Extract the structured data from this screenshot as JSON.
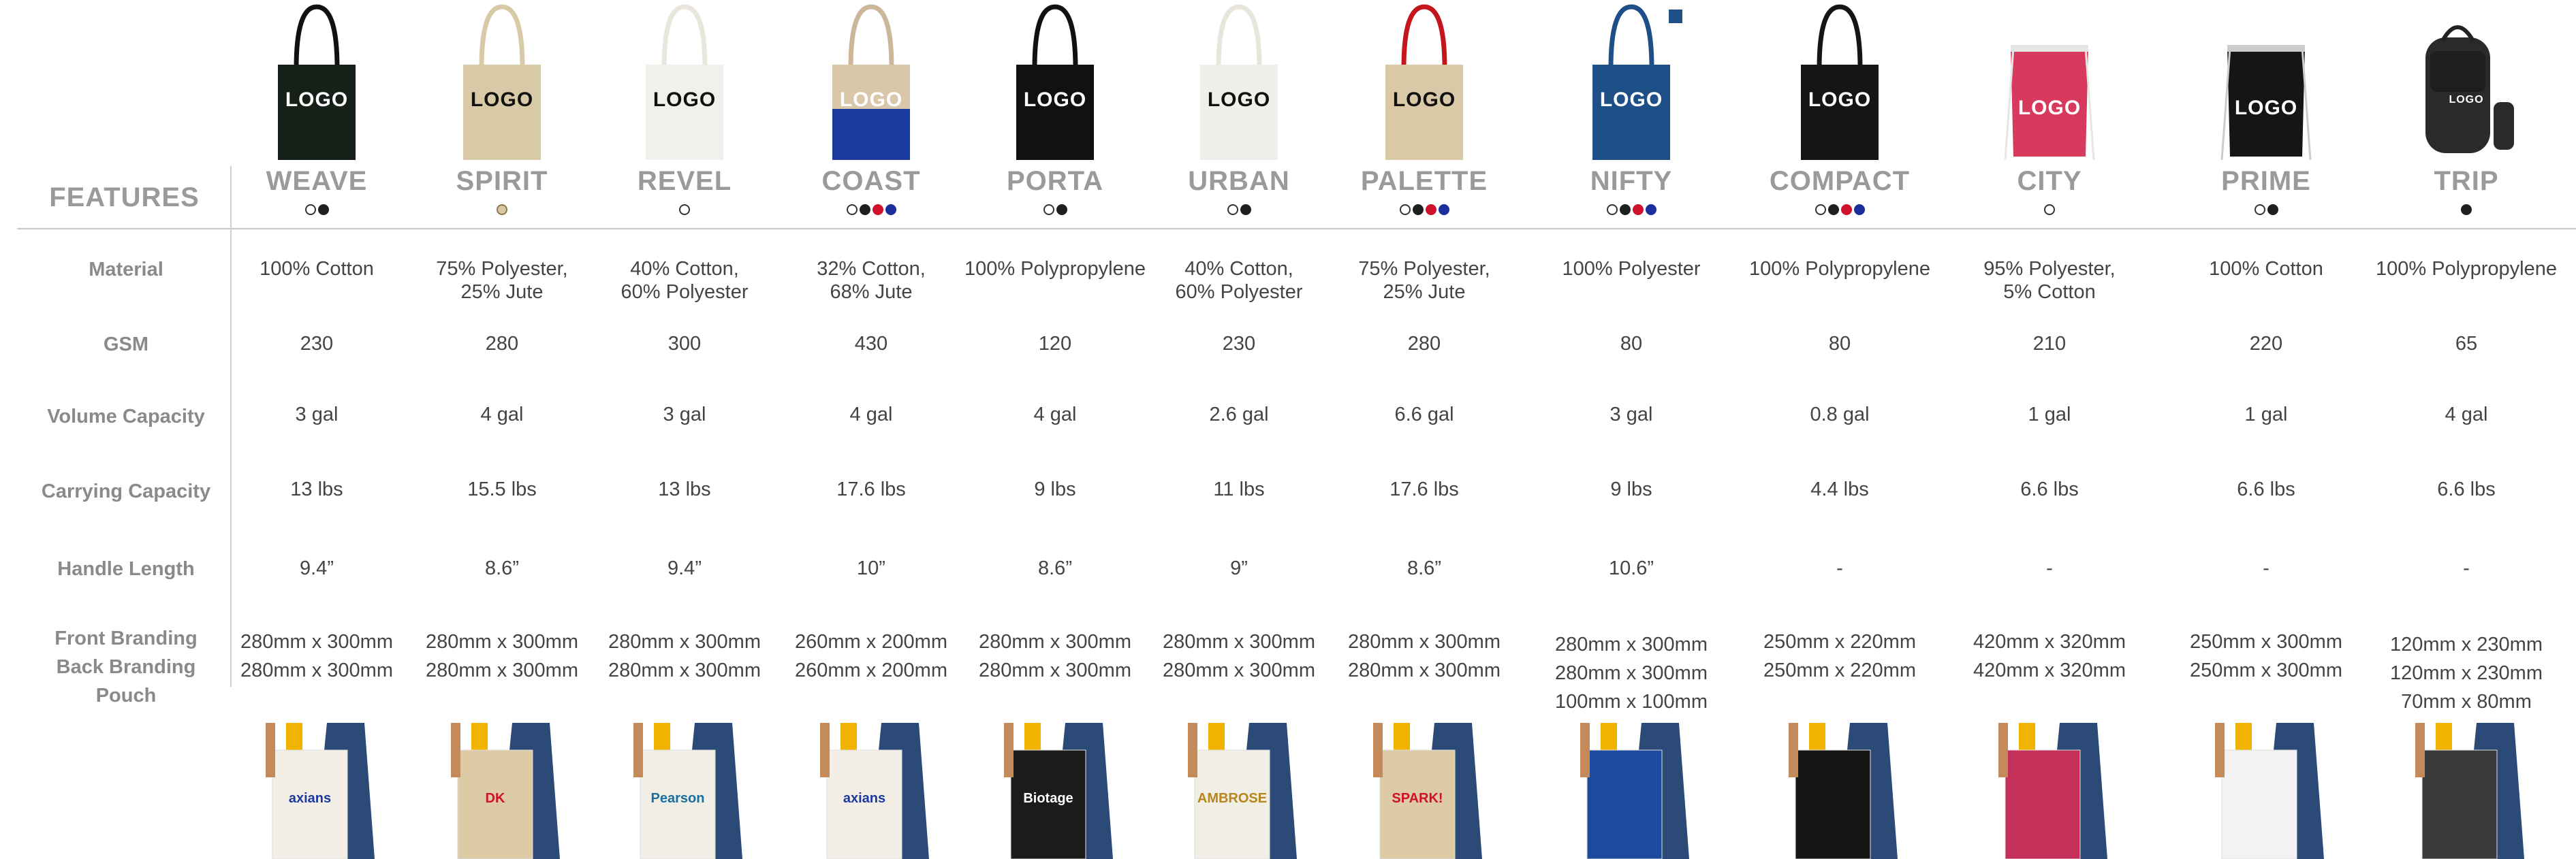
{
  "features_title": "FEATURES",
  "row_labels": [
    "Material",
    "GSM",
    "Volume Capacity",
    "Carrying Capacity",
    "Handle Length",
    "Front Branding",
    "Back Branding",
    "Pouch"
  ],
  "products": [
    {
      "name": "WEAVE",
      "logo": "LOGO",
      "colors": [
        "#ffffff",
        "#1f1f1f"
      ],
      "bag_color": "#142018",
      "handle_color": "#111111",
      "logo_color": "#ffffff",
      "material": [
        "100% Cotton"
      ],
      "gsm": "230",
      "volume": "3 gal",
      "carry": "13 lbs",
      "handle": "9.4”",
      "branding": [
        "280mm x 300mm",
        "280mm x 300mm"
      ],
      "photo_brand": "axians",
      "photo_bag": "#f3efe6"
    },
    {
      "name": "SPIRIT",
      "logo": "LOGO",
      "colors": [
        "#d9c9a3"
      ],
      "bag_color": "#d8c9a7",
      "handle_color": "#d8c9a7",
      "logo_color": "#111111",
      "material": [
        "75% Polyester,",
        "25% Jute"
      ],
      "gsm": "280",
      "volume": "4 gal",
      "carry": "15.5 lbs",
      "handle": "8.6”",
      "branding": [
        "280mm x 300mm",
        "280mm x 300mm"
      ],
      "photo_brand": "DK",
      "photo_bag": "#dccba4"
    },
    {
      "name": "REVEL",
      "logo": "LOGO",
      "colors": [
        "#ffffff"
      ],
      "bag_color": "#f2f0ea",
      "handle_color": "#e9e6dd",
      "logo_color": "#111111",
      "material": [
        "40% Cotton,",
        "60% Polyester"
      ],
      "gsm": "300",
      "volume": "3 gal",
      "carry": "13 lbs",
      "handle": "9.4”",
      "branding": [
        "280mm x 300mm",
        "280mm x 300mm"
      ],
      "photo_brand": "Pearson",
      "photo_bag": "#f1eee6"
    },
    {
      "name": "COAST",
      "logo": "LOGO",
      "colors": [
        "#ffffff",
        "#1f1f1f",
        "#d0112b",
        "#1a2f9c"
      ],
      "bag_color": "#d9c7aa",
      "handle_color": "#cdb79a",
      "logo_color": "#ffffff",
      "material": [
        "32% Cotton,",
        "68% Jute"
      ],
      "gsm": "430",
      "volume": "4 gal",
      "carry": "17.6 lbs",
      "handle": "10”",
      "branding": [
        "260mm x 200mm",
        "260mm x 200mm"
      ],
      "photo_brand": "axians",
      "photo_bag": "#f3efe6"
    },
    {
      "name": "PORTA",
      "logo": "LOGO",
      "colors": [
        "#ffffff",
        "#1f1f1f"
      ],
      "bag_color": "#111111",
      "handle_color": "#111111",
      "logo_color": "#ffffff",
      "material": [
        "100% Polypropylene"
      ],
      "gsm": "120",
      "volume": "4 gal",
      "carry": "9 lbs",
      "handle": "8.6”",
      "branding": [
        "280mm x 300mm",
        "280mm x 300mm"
      ],
      "photo_brand": "Biotage",
      "photo_bag": "#1b1b1b"
    },
    {
      "name": "URBAN",
      "logo": "LOGO",
      "colors": [
        "#ffffff",
        "#1f1f1f"
      ],
      "bag_color": "#f1efe9",
      "handle_color": "#e8e5dc",
      "logo_color": "#111111",
      "material": [
        "40% Cotton,",
        "60% Polyester"
      ],
      "gsm": "230",
      "volume": "2.6 gal",
      "carry": "11 lbs",
      "handle": "9”",
      "branding": [
        "280mm x 300mm",
        "280mm x 300mm"
      ],
      "photo_brand": "AMBROSE",
      "photo_bag": "#f1eee6"
    },
    {
      "name": "PALETTE",
      "logo": "LOGO",
      "colors": [
        "#ffffff",
        "#1f1f1f",
        "#d0112b",
        "#1a2f9c"
      ],
      "bag_color": "#dac9a6",
      "handle_color": "#c4161c",
      "logo_color": "#111111",
      "material": [
        "75% Polyester,",
        "25% Jute"
      ],
      "gsm": "280",
      "volume": "6.6 gal",
      "carry": "17.6 lbs",
      "handle": "8.6”",
      "branding": [
        "280mm x 300mm",
        "280mm x 300mm"
      ],
      "photo_brand": "SPARK!",
      "photo_bag": "#dccba4"
    },
    {
      "name": "NIFTY",
      "logo": "LOGO",
      "colors": [
        "#ffffff",
        "#1f1f1f",
        "#d0112b",
        "#1a2f9c"
      ],
      "bag_color": "#1e4f86",
      "handle_color": "#1e4f86",
      "logo_color": "#ffffff",
      "material": [
        "100% Polyester"
      ],
      "gsm": "80",
      "volume": "3 gal",
      "carry": "9 lbs",
      "handle": "10.6”",
      "branding": [
        "280mm x 300mm",
        "280mm x 300mm",
        "100mm x 100mm"
      ],
      "photo_brand": "",
      "photo_bag": "#1e4aa0"
    },
    {
      "name": "COMPACT",
      "logo": "LOGO",
      "colors": [
        "#ffffff",
        "#1f1f1f",
        "#d0112b",
        "#1a2f9c"
      ],
      "bag_color": "#151515",
      "handle_color": "#151515",
      "logo_color": "#ffffff",
      "material": [
        "100% Polypropylene"
      ],
      "gsm": "80",
      "volume": "0.8 gal",
      "carry": "4.4 lbs",
      "handle": "-",
      "branding": [
        "250mm x 220mm",
        "250mm x 220mm"
      ],
      "photo_brand": "",
      "photo_bag": "#151515"
    },
    {
      "name": "CITY",
      "logo": "LOGO",
      "colors": [
        "#ffffff"
      ],
      "bag_color": "#d73a5c",
      "handle_color": "#e6e6e6",
      "logo_color": "#ffffff",
      "material": [
        "95% Polyester,",
        "5% Cotton"
      ],
      "gsm": "210",
      "volume": "1 gal",
      "carry": "6.6 lbs",
      "handle": "-",
      "branding": [
        "420mm x 320mm",
        "420mm x 320mm"
      ],
      "photo_brand": "",
      "photo_bag": "#c4305a"
    },
    {
      "name": "PRIME",
      "logo": "LOGO",
      "colors": [
        "#ffffff",
        "#1f1f1f"
      ],
      "bag_color": "#151515",
      "handle_color": "#cccccc",
      "logo_color": "#ffffff",
      "material": [
        "100% Cotton"
      ],
      "gsm": "220",
      "volume": "1 gal",
      "carry": "6.6 lbs",
      "handle": "-",
      "branding": [
        "250mm x 300mm",
        "250mm x 300mm"
      ],
      "photo_brand": "",
      "photo_bag": "#f2f2f2"
    },
    {
      "name": "TRIP",
      "logo": "LOGO",
      "colors": [
        "#1f1f1f"
      ],
      "bag_color": "#2a2a2a",
      "handle_color": "#2a2a2a",
      "logo_color": "#ffffff",
      "material": [
        "100% Polypropylene"
      ],
      "gsm": "65",
      "volume": "4 gal",
      "carry": "6.6 lbs",
      "handle": "-",
      "branding": [
        "120mm x 230mm",
        "120mm x 230mm",
        "70mm x 80mm"
      ],
      "photo_brand": "",
      "photo_bag": "#3a3a3a"
    }
  ]
}
